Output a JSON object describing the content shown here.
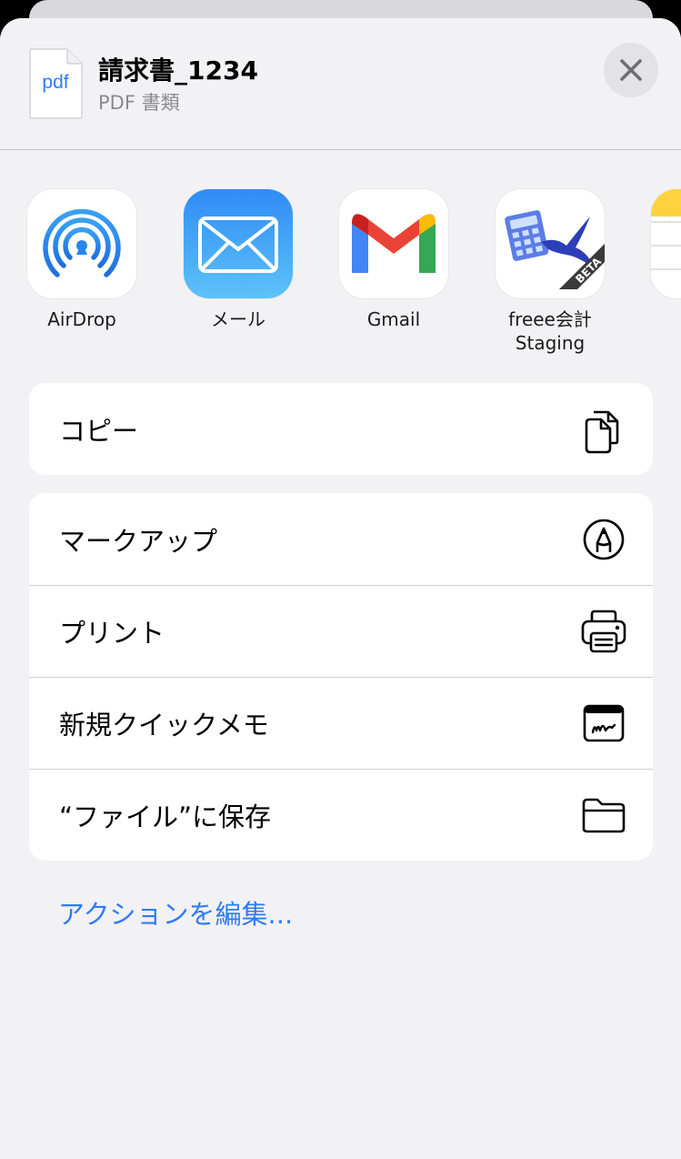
{
  "file": {
    "title": "請求書_1234",
    "subtitle": "PDF 書類",
    "icon_text": "pdf",
    "icon_name": "pdf-file-icon"
  },
  "close": {
    "icon_name": "close-icon"
  },
  "apps": [
    {
      "label": "AirDrop",
      "icon_name": "airdrop-icon"
    },
    {
      "label": "メール",
      "icon_name": "mail-icon"
    },
    {
      "label": "Gmail",
      "icon_name": "gmail-icon"
    },
    {
      "label": "freee会計\nStaging",
      "icon_name": "freee-staging-icon",
      "badge": "BETA"
    },
    {
      "label": "",
      "icon_name": "notes-icon"
    }
  ],
  "actions_group1": [
    {
      "label": "コピー",
      "icon_name": "copy-icon"
    }
  ],
  "actions_group2": [
    {
      "label": "マークアップ",
      "icon_name": "markup-icon"
    },
    {
      "label": "プリント",
      "icon_name": "printer-icon"
    },
    {
      "label": "新規クイックメモ",
      "icon_name": "quick-note-icon"
    },
    {
      "label": "“ファイル”に保存",
      "icon_name": "folder-icon"
    }
  ],
  "edit_actions": {
    "label": "アクションを編集..."
  },
  "colors": {
    "accent": "#2f7cf6",
    "sheet_bg": "#f2f2f4",
    "row_bg": "#ffffff",
    "separator": "#d1d1d6"
  }
}
